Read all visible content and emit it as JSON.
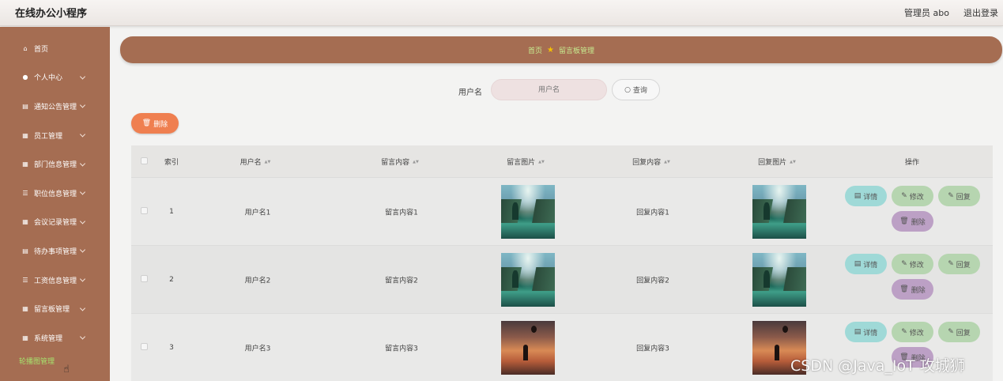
{
  "app": {
    "title": "在线办公小程序"
  },
  "header": {
    "user": "管理员 abo",
    "logout": "退出登录"
  },
  "sidebar": {
    "items": [
      {
        "label": "首页",
        "icon": "home-icon",
        "glyph": "⌂",
        "chevron": false
      },
      {
        "label": "个人中心",
        "icon": "user-icon",
        "glyph": "●",
        "chevron": true
      },
      {
        "label": "通知公告管理",
        "icon": "doc-icon",
        "glyph": "▤",
        "chevron": true
      },
      {
        "label": "员工管理",
        "icon": "grid-icon",
        "glyph": "▦",
        "chevron": true
      },
      {
        "label": "部门信息管理",
        "icon": "grid-icon",
        "glyph": "▦",
        "chevron": true
      },
      {
        "label": "职位信息管理",
        "icon": "sliders-icon",
        "glyph": "☰",
        "chevron": true
      },
      {
        "label": "会议记录管理",
        "icon": "grid-icon",
        "glyph": "▦",
        "chevron": true
      },
      {
        "label": "待办事项管理",
        "icon": "doc-icon",
        "glyph": "▤",
        "chevron": true
      },
      {
        "label": "工资信息管理",
        "icon": "list-icon",
        "glyph": "☰",
        "chevron": true
      },
      {
        "label": "留言板管理",
        "icon": "grid-icon",
        "glyph": "▦",
        "chevron": true
      },
      {
        "label": "系统管理",
        "icon": "grid-icon",
        "glyph": "▦",
        "chevron": true
      }
    ],
    "sub_item": "轮播图管理"
  },
  "breadcrumb": {
    "home": "首页",
    "current": "留言板管理"
  },
  "search": {
    "label": "用户名",
    "placeholder": "用户名",
    "button": "查询"
  },
  "toolbar": {
    "delete": "删除"
  },
  "table": {
    "columns": [
      "索引",
      "用户名",
      "留言内容",
      "留言图片",
      "回复内容",
      "回复图片",
      "操作"
    ],
    "rows": [
      {
        "index": "1",
        "username": "用户名1",
        "content": "留言内容1",
        "image": "lake",
        "reply": "回复内容1",
        "reply_image": "lake"
      },
      {
        "index": "2",
        "username": "用户名2",
        "content": "留言内容2",
        "image": "lake",
        "reply": "回复内容2",
        "reply_image": "lake"
      },
      {
        "index": "3",
        "username": "用户名3",
        "content": "留言内容3",
        "image": "sunset",
        "reply": "回复内容3",
        "reply_image": "sunset"
      }
    ],
    "actions": {
      "detail": "详情",
      "edit": "修改",
      "reply": "回复",
      "delete": "删除"
    }
  },
  "watermark": "CSDN @Java_IoT 攻城狮",
  "colors": {
    "sidebar": "#a56d52",
    "accent_green": "#a6e36d",
    "delete_orange": "#ef7f50"
  }
}
